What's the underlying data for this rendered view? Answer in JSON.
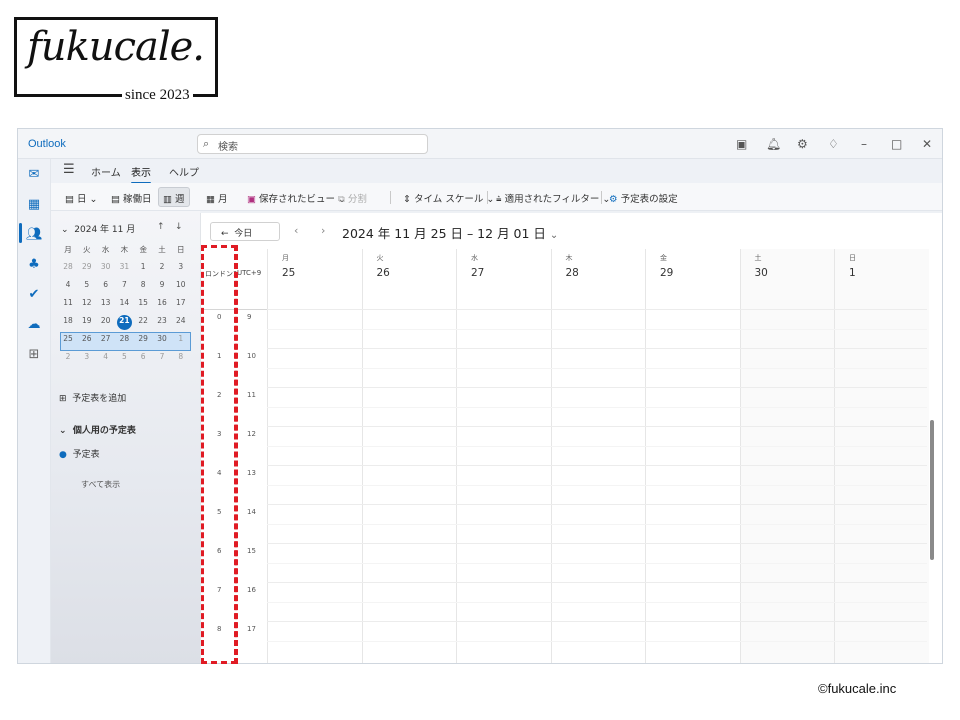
{
  "logo": {
    "text": "fukucale.",
    "since": "since 2023"
  },
  "credit": "©fukucale.inc",
  "app": {
    "title": "Outlook",
    "search_placeholder": "検索",
    "menus": [
      "ホーム",
      "表示",
      "ヘルプ"
    ],
    "active_menu": "表示",
    "ribbon": {
      "day": "日",
      "workweek": "稼働日",
      "week": "週",
      "month": "月",
      "saved_views": "保存されたビュー",
      "split": "分割",
      "timescale": "タイム スケール",
      "filters": "適用されたフィルター",
      "settings": "予定表の設定"
    }
  },
  "mini_calendar": {
    "month_label": "2024 年 11 月",
    "weekdays": [
      "月",
      "火",
      "水",
      "木",
      "金",
      "土",
      "日"
    ],
    "weeks": [
      [
        "28",
        "29",
        "30",
        "31",
        "1",
        "2",
        "3"
      ],
      [
        "4",
        "5",
        "6",
        "7",
        "8",
        "9",
        "10"
      ],
      [
        "11",
        "12",
        "13",
        "14",
        "15",
        "16",
        "17"
      ],
      [
        "18",
        "19",
        "20",
        "21",
        "22",
        "23",
        "24"
      ],
      [
        "25",
        "26",
        "27",
        "28",
        "29",
        "30",
        "1"
      ],
      [
        "2",
        "3",
        "4",
        "5",
        "6",
        "7",
        "8"
      ]
    ],
    "today": "21"
  },
  "sidebar": {
    "add_calendar": "予定表を追加",
    "group": "個人用の予定表",
    "calendar": "予定表",
    "show_all": "すべて表示"
  },
  "calendar": {
    "today_button": "今日",
    "range": "2024 年 11 月 25 日 – 12 月 01 日",
    "tz1": "ロンドン1",
    "tz2": "UTC+9",
    "days": [
      {
        "name": "月",
        "num": "25"
      },
      {
        "name": "火",
        "num": "26"
      },
      {
        "name": "水",
        "num": "27"
      },
      {
        "name": "木",
        "num": "28"
      },
      {
        "name": "金",
        "num": "29"
      },
      {
        "name": "土",
        "num": "30"
      },
      {
        "name": "日",
        "num": "1"
      }
    ],
    "hours_tz1": [
      "0",
      "1",
      "2",
      "3",
      "4",
      "5",
      "6",
      "7",
      "8"
    ],
    "hours_tz2": [
      "9",
      "10",
      "11",
      "12",
      "13",
      "14",
      "15",
      "16",
      "17"
    ]
  }
}
